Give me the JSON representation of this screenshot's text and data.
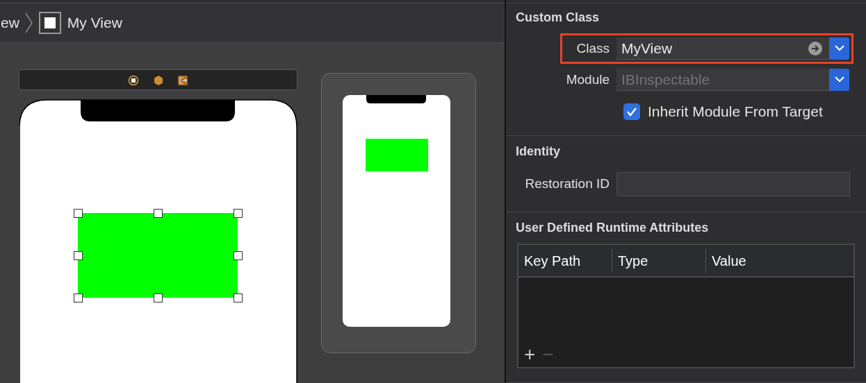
{
  "breadcrumb": [
    {
      "label": "ew",
      "kind": "text"
    },
    {
      "label": "My View",
      "kind": "view"
    }
  ],
  "custom_class": {
    "title": "Custom Class",
    "fields": [
      {
        "label": "Class",
        "value": "MyView",
        "disabled": false,
        "highlighted": true,
        "has_arrow": true
      },
      {
        "label": "Module",
        "value": "IBInspectable",
        "disabled": true,
        "highlighted": false,
        "has_arrow": false
      }
    ],
    "checkbox": {
      "label": "Inherit Module From Target",
      "checked": true
    }
  },
  "identity": {
    "title": "Identity",
    "fields": [
      {
        "label": "Restoration ID"
      }
    ]
  },
  "runtime_attributes": {
    "title": "User Defined Runtime Attributes",
    "columns": [
      "Key Path",
      "Type",
      "Value"
    ],
    "add": "+",
    "remove": "−"
  }
}
